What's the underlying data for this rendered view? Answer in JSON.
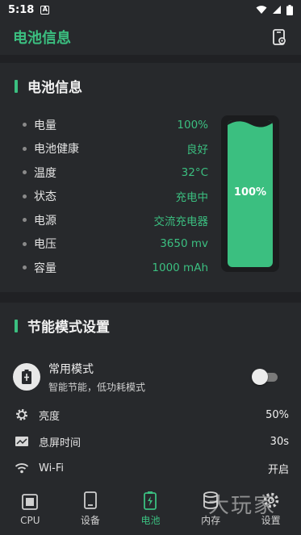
{
  "status_bar": {
    "time": "5:18",
    "badge": "A"
  },
  "app_bar": {
    "title": "电池信息",
    "tool_icon": "phone-settings-icon"
  },
  "battery_info": {
    "title": "电池信息",
    "rows": [
      {
        "label": "电量",
        "value": "100%"
      },
      {
        "label": "电池健康",
        "value": "良好"
      },
      {
        "label": "温度",
        "value": "32°C"
      },
      {
        "label": "状态",
        "value": "充电中"
      },
      {
        "label": "电源",
        "value": "交流充电器"
      },
      {
        "label": "电压",
        "value": "3650 mv"
      },
      {
        "label": "容量",
        "value": "1000 mAh"
      }
    ],
    "level_percent": 100,
    "level_label": "100%"
  },
  "power_saving": {
    "title": "节能模式设置",
    "mode": {
      "name": "常用模式",
      "description": "智能节能，低功耗模式",
      "enabled": false
    },
    "settings": [
      {
        "icon": "gear-icon",
        "label": "亮度",
        "value": "50%"
      },
      {
        "icon": "screen-timeout-icon",
        "label": "息屏时间",
        "value": "30s"
      },
      {
        "icon": "wifi-icon",
        "label": "Wi-Fi",
        "value": "开启"
      }
    ]
  },
  "nav": {
    "items": [
      {
        "icon": "cpu-icon",
        "label": "CPU"
      },
      {
        "icon": "device-icon",
        "label": "设备"
      },
      {
        "icon": "battery-icon",
        "label": "电池"
      },
      {
        "icon": "storage-icon",
        "label": "内存"
      },
      {
        "icon": "settings-icon",
        "label": "设置"
      }
    ],
    "active_index": 2
  },
  "watermark": "大玩家",
  "colors": {
    "accent": "#3bbf80",
    "background": "#202124",
    "card": "#27292c"
  }
}
